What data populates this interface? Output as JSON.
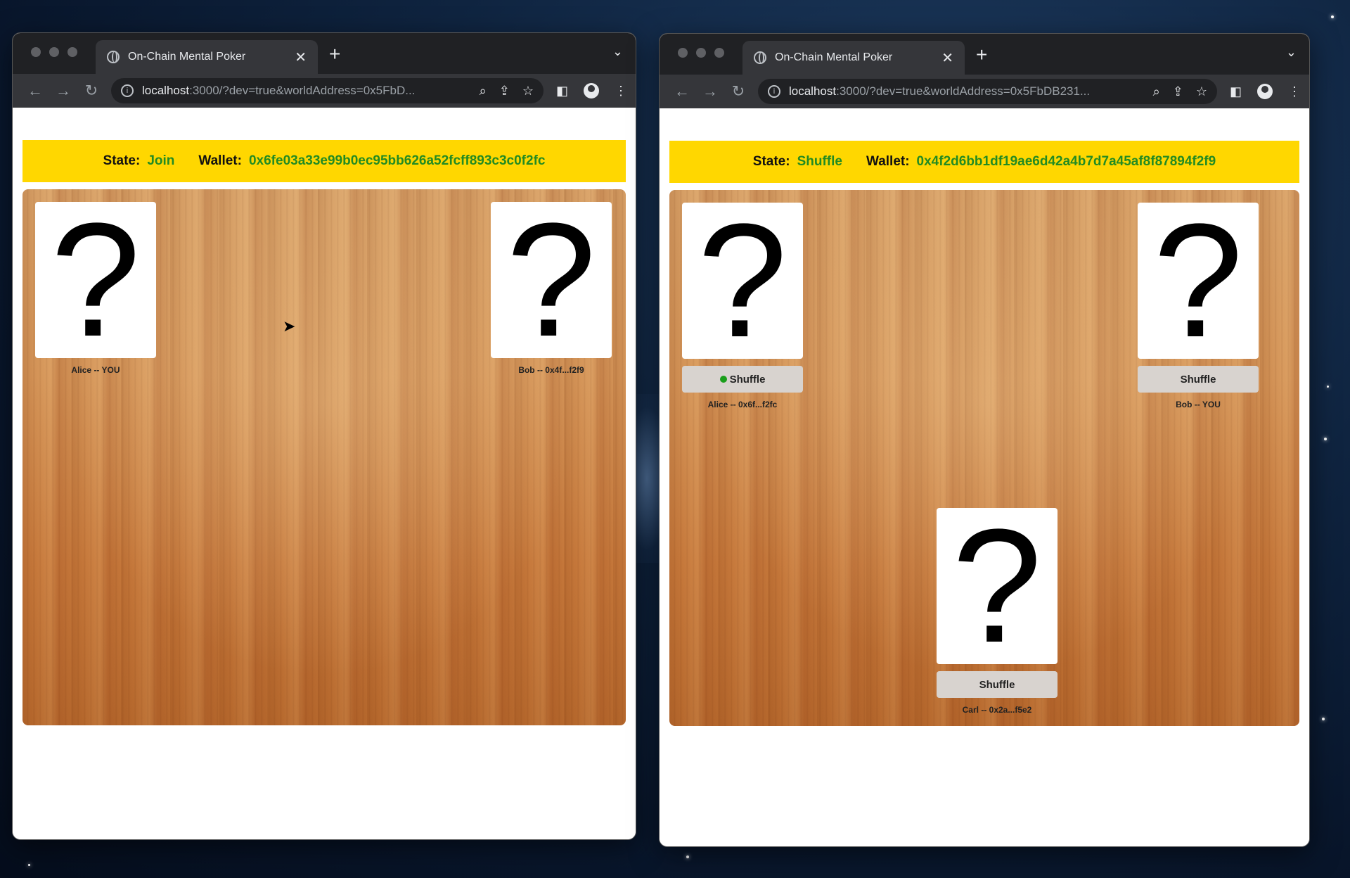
{
  "windows": [
    {
      "tab_title": "On-Chain Mental Poker",
      "url_host": "localhost",
      "url_rest": ":3000/?dev=true&worldAddress=0x5FbD...",
      "state_label": "State:",
      "state_value": "Join",
      "wallet_label": "Wallet:",
      "wallet_value": "0x6fe03a33e99b0ec95bb626a52fcff893c3c0f2fc",
      "players": [
        {
          "card": "?",
          "name": "Alice -- YOU"
        },
        {
          "card": "?",
          "name": "Bob -- 0x4f...f2f9"
        }
      ]
    },
    {
      "tab_title": "On-Chain Mental Poker",
      "url_host": "localhost",
      "url_rest": ":3000/?dev=true&worldAddress=0x5FbDB231...",
      "state_label": "State:",
      "state_value": "Shuffle",
      "wallet_label": "Wallet:",
      "wallet_value": "0x4f2d6bb1df19ae6d42a4b7d7a45af8f87894f2f9",
      "players": [
        {
          "card": "?",
          "action": "Shuffle",
          "active": true,
          "name": "Alice -- 0x6f...f2fc"
        },
        {
          "card": "?",
          "action": "Shuffle",
          "active": false,
          "name": "Bob -- YOU"
        },
        {
          "card": "?",
          "action": "Shuffle",
          "active": false,
          "name": "Carl -- 0x2a...f5e2"
        }
      ]
    }
  ],
  "icons": {
    "back": "←",
    "forward": "→",
    "reload": "↻",
    "close": "✕",
    "new_tab": "+",
    "tab_menu": "⌄",
    "zoom": "⌕",
    "share": "⇪",
    "star": "☆",
    "sidepanel": "◧",
    "menu": "⋮"
  },
  "colors": {
    "status_bg": "#ffd700",
    "status_value": "#228b22",
    "active_dot": "#1a9e1a"
  }
}
